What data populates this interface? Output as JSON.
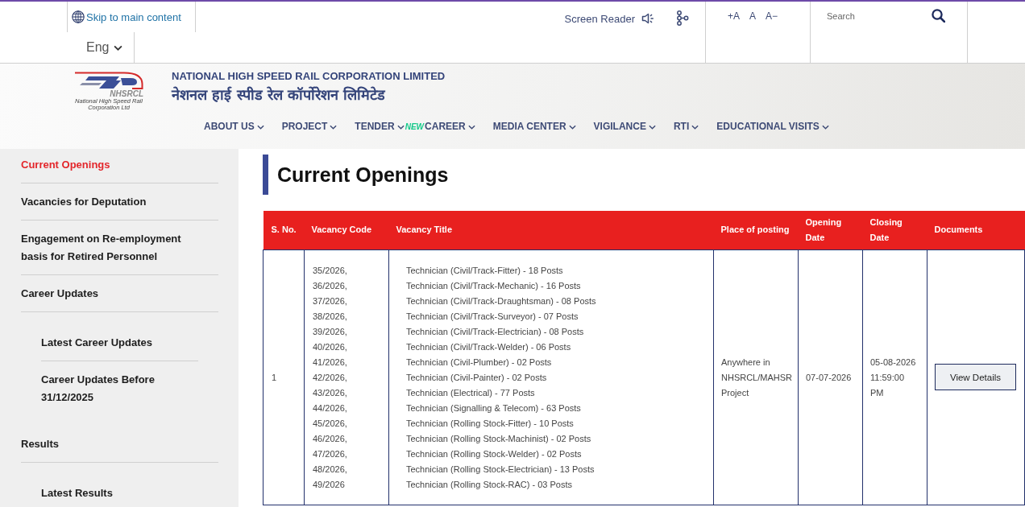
{
  "top_bar": {
    "skip_link": "Skip to main content",
    "language": "Eng",
    "screen_reader": "Screen Reader",
    "text_size": [
      {
        "label": "+A"
      },
      {
        "label": "A"
      },
      {
        "label": "A−"
      }
    ],
    "search": {
      "placeholder": "Search"
    }
  },
  "header": {
    "logo": {
      "mark": "NHSRCL",
      "tagline": "National High Speed Rail Corporation Ltd"
    },
    "title": "NATIONAL HIGH SPEED RAIL CORPORATION LIMITED",
    "title_hindi": "नेशनल हाई स्पीड रेल कॉर्पोरेशन लिमिटेड"
  },
  "nav": [
    {
      "label": "ABOUT US"
    },
    {
      "label": "PROJECT"
    },
    {
      "label": "TENDER"
    },
    {
      "label": "CAREER",
      "badge": "NEW"
    },
    {
      "label": "MEDIA CENTER"
    },
    {
      "label": "VIGILANCE"
    },
    {
      "label": "RTI"
    },
    {
      "label": "EDUCATIONAL VISITS"
    }
  ],
  "sidebar": {
    "items": [
      {
        "label": "Current Openings",
        "selected": true
      },
      {
        "label": "Vacancies for Deputation",
        "selected": false
      },
      {
        "label": "Engagement on Re-employment basis for Retired Personnel",
        "selected": false
      },
      {
        "label": "Career Updates",
        "selected": false,
        "children": [
          {
            "label": "Latest Career Updates",
            "selected": false
          },
          {
            "label": "Career Updates Before 31/12/2025",
            "selected": false
          }
        ]
      },
      {
        "label": "Results",
        "selected": false,
        "children": [
          {
            "label": "Latest Results",
            "selected": false
          }
        ]
      }
    ]
  },
  "main": {
    "heading": "Current Openings",
    "table": {
      "columns": [
        "S. No.",
        "Vacancy Code",
        "Vacancy Title",
        "Place of posting",
        "Opening Date",
        "Closing Date",
        "Documents"
      ],
      "rows": [
        {
          "s_no": "1",
          "vacancy_codes": [
            "35/2026,",
            "36/2026,",
            "37/2026,",
            "38/2026,",
            "39/2026,",
            "40/2026,",
            "41/2026,",
            "42/2026,",
            "43/2026,",
            "44/2026,",
            "45/2026,",
            "46/2026,",
            "47/2026,",
            "48/2026,",
            "49/2026"
          ],
          "vacancy_titles": [
            "Technician (Civil/Track-Fitter) - 18 Posts",
            "Technician (Civil/Track-Mechanic) - 16 Posts",
            "Technician (Civil/Track-Draughtsman) - 08 Posts",
            "Technician (Civil/Track-Surveyor) - 07 Posts",
            "Technician (Civil/Track-Electrician) - 08 Posts",
            "Technician (Civil/Track-Welder) - 06 Posts",
            "Technician (Civil-Plumber) - 02 Posts",
            "Technician (Civil-Painter) - 02 Posts",
            "Technician (Electrical) - 77 Posts",
            "Technician (Signalling & Telecom) - 63 Posts",
            "Technician (Rolling Stock-Fitter) - 10 Posts",
            "Technician (Rolling Stock-Machinist) - 02 Posts",
            "Technician (Rolling Stock-Welder) - 02 Posts",
            "Technician (Rolling Stock-Electrician) - 13 Posts",
            "Technician (Rolling Stock-RAC) - 03 Posts"
          ],
          "place": "Anywhere in NHSRCL/MAHSR Project",
          "opening_date": "07-07-2026",
          "closing_date": "05-08-2026 11:59:00 PM",
          "documents": {
            "button": "View Details"
          }
        }
      ]
    }
  }
}
